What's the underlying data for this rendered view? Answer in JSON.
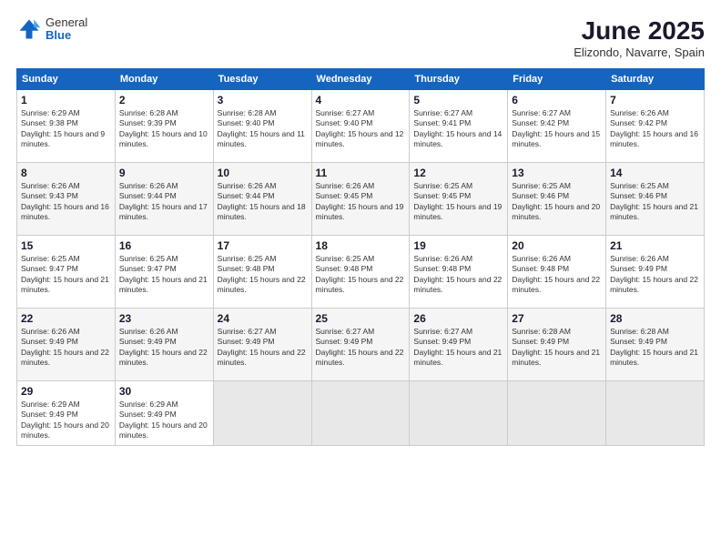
{
  "logo": {
    "general": "General",
    "blue": "Blue"
  },
  "title": {
    "month": "June 2025",
    "location": "Elizondo, Navarre, Spain"
  },
  "weekdays": [
    "Sunday",
    "Monday",
    "Tuesday",
    "Wednesday",
    "Thursday",
    "Friday",
    "Saturday"
  ],
  "weeks": [
    [
      {
        "day": "1",
        "sunrise": "6:29 AM",
        "sunset": "9:38 PM",
        "daylight": "15 hours and 9 minutes."
      },
      {
        "day": "2",
        "sunrise": "6:28 AM",
        "sunset": "9:39 PM",
        "daylight": "15 hours and 10 minutes."
      },
      {
        "day": "3",
        "sunrise": "6:28 AM",
        "sunset": "9:40 PM",
        "daylight": "15 hours and 11 minutes."
      },
      {
        "day": "4",
        "sunrise": "6:27 AM",
        "sunset": "9:40 PM",
        "daylight": "15 hours and 12 minutes."
      },
      {
        "day": "5",
        "sunrise": "6:27 AM",
        "sunset": "9:41 PM",
        "daylight": "15 hours and 14 minutes."
      },
      {
        "day": "6",
        "sunrise": "6:27 AM",
        "sunset": "9:42 PM",
        "daylight": "15 hours and 15 minutes."
      },
      {
        "day": "7",
        "sunrise": "6:26 AM",
        "sunset": "9:42 PM",
        "daylight": "15 hours and 16 minutes."
      }
    ],
    [
      {
        "day": "8",
        "sunrise": "6:26 AM",
        "sunset": "9:43 PM",
        "daylight": "15 hours and 16 minutes."
      },
      {
        "day": "9",
        "sunrise": "6:26 AM",
        "sunset": "9:44 PM",
        "daylight": "15 hours and 17 minutes."
      },
      {
        "day": "10",
        "sunrise": "6:26 AM",
        "sunset": "9:44 PM",
        "daylight": "15 hours and 18 minutes."
      },
      {
        "day": "11",
        "sunrise": "6:26 AM",
        "sunset": "9:45 PM",
        "daylight": "15 hours and 19 minutes."
      },
      {
        "day": "12",
        "sunrise": "6:25 AM",
        "sunset": "9:45 PM",
        "daylight": "15 hours and 19 minutes."
      },
      {
        "day": "13",
        "sunrise": "6:25 AM",
        "sunset": "9:46 PM",
        "daylight": "15 hours and 20 minutes."
      },
      {
        "day": "14",
        "sunrise": "6:25 AM",
        "sunset": "9:46 PM",
        "daylight": "15 hours and 21 minutes."
      }
    ],
    [
      {
        "day": "15",
        "sunrise": "6:25 AM",
        "sunset": "9:47 PM",
        "daylight": "15 hours and 21 minutes."
      },
      {
        "day": "16",
        "sunrise": "6:25 AM",
        "sunset": "9:47 PM",
        "daylight": "15 hours and 21 minutes."
      },
      {
        "day": "17",
        "sunrise": "6:25 AM",
        "sunset": "9:48 PM",
        "daylight": "15 hours and 22 minutes."
      },
      {
        "day": "18",
        "sunrise": "6:25 AM",
        "sunset": "9:48 PM",
        "daylight": "15 hours and 22 minutes."
      },
      {
        "day": "19",
        "sunrise": "6:26 AM",
        "sunset": "9:48 PM",
        "daylight": "15 hours and 22 minutes."
      },
      {
        "day": "20",
        "sunrise": "6:26 AM",
        "sunset": "9:48 PM",
        "daylight": "15 hours and 22 minutes."
      },
      {
        "day": "21",
        "sunrise": "6:26 AM",
        "sunset": "9:49 PM",
        "daylight": "15 hours and 22 minutes."
      }
    ],
    [
      {
        "day": "22",
        "sunrise": "6:26 AM",
        "sunset": "9:49 PM",
        "daylight": "15 hours and 22 minutes."
      },
      {
        "day": "23",
        "sunrise": "6:26 AM",
        "sunset": "9:49 PM",
        "daylight": "15 hours and 22 minutes."
      },
      {
        "day": "24",
        "sunrise": "6:27 AM",
        "sunset": "9:49 PM",
        "daylight": "15 hours and 22 minutes."
      },
      {
        "day": "25",
        "sunrise": "6:27 AM",
        "sunset": "9:49 PM",
        "daylight": "15 hours and 22 minutes."
      },
      {
        "day": "26",
        "sunrise": "6:27 AM",
        "sunset": "9:49 PM",
        "daylight": "15 hours and 21 minutes."
      },
      {
        "day": "27",
        "sunrise": "6:28 AM",
        "sunset": "9:49 PM",
        "daylight": "15 hours and 21 minutes."
      },
      {
        "day": "28",
        "sunrise": "6:28 AM",
        "sunset": "9:49 PM",
        "daylight": "15 hours and 21 minutes."
      }
    ],
    [
      {
        "day": "29",
        "sunrise": "6:29 AM",
        "sunset": "9:49 PM",
        "daylight": "15 hours and 20 minutes."
      },
      {
        "day": "30",
        "sunrise": "6:29 AM",
        "sunset": "9:49 PM",
        "daylight": "15 hours and 20 minutes."
      },
      null,
      null,
      null,
      null,
      null
    ]
  ]
}
